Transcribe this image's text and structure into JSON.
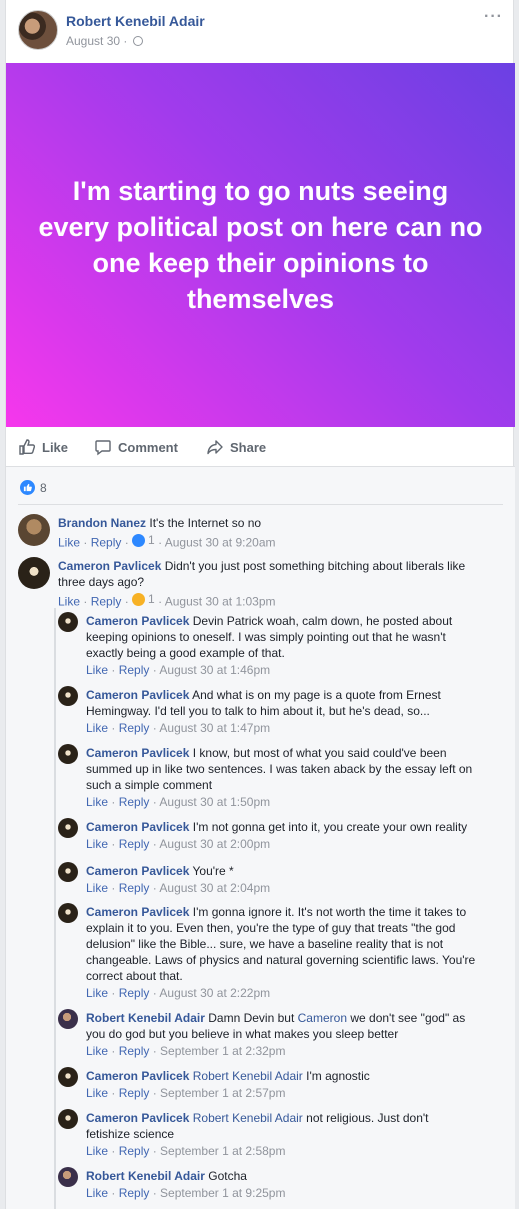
{
  "post": {
    "author": "Robert Kenebil Adair",
    "date": "August 30 ·",
    "more": "···",
    "status_text": "I'm starting to go nuts seeing every political post on here can no one keep their opinions to themselves",
    "banner_gradient": [
      "#f637ec",
      "#a13bec",
      "#6b40e3"
    ]
  },
  "actions": {
    "like": "Like",
    "comment": "Comment",
    "share": "Share"
  },
  "reactions": {
    "count": "8"
  },
  "comments": [
    {
      "name": "Brandon Nanez",
      "text": "It's the Internet so no",
      "like": "Like",
      "reply": "Reply",
      "react_count": "1",
      "time": "August 30 at 9:20am"
    },
    {
      "name": "Cameron Pavlicek",
      "text": "Didn't you just post something bitching about liberals like three days ago?",
      "like": "Like",
      "reply": "Reply",
      "react_count": "1",
      "time": "August 30 at 1:03pm"
    }
  ],
  "replies": [
    {
      "name": "Cameron Pavlicek",
      "tag": "",
      "text": "Devin Patrick woah, calm down, he posted about keeping opinions to oneself. I was simply pointing out that he wasn't exactly being a good example of that.",
      "like": "Like",
      "reply": "Reply",
      "time": "August 30 at 1:46pm"
    },
    {
      "name": "Cameron Pavlicek",
      "tag": "",
      "text": "And what is on my page is a quote from Ernest Hemingway. I'd tell you to talk to him about it, but he's dead, so...",
      "like": "Like",
      "reply": "Reply",
      "time": "August 30 at 1:47pm"
    },
    {
      "name": "Cameron Pavlicek",
      "tag": "",
      "text": "I know, but most of what you said could've been summed up in like two sentences. I was taken aback by the essay left on such a simple comment",
      "like": "Like",
      "reply": "Reply",
      "time": "August 30 at 1:50pm"
    },
    {
      "name": "Cameron Pavlicek",
      "tag": "",
      "text": "I'm not gonna get into it, you create your own reality",
      "like": "Like",
      "reply": "Reply",
      "time": "August 30 at 2:00pm"
    },
    {
      "name": "Cameron Pavlicek",
      "tag": "",
      "text": "You're *",
      "like": "Like",
      "reply": "Reply",
      "time": "August 30 at 2:04pm"
    },
    {
      "name": "Cameron Pavlicek",
      "tag": "",
      "text": "I'm gonna ignore it. It's not worth the time it takes to explain it to you. Even then, you're the type of guy that treats \"the god delusion\" like the Bible... sure, we have a baseline reality that is not changeable. Laws of physics and natural governing scientific laws. You're correct about that.",
      "like": "Like",
      "reply": "Reply",
      "time": "August 30 at 2:22pm"
    },
    {
      "name": "Robert Kenebil Adair",
      "tag": "",
      "text_pre": "Damn Devin but",
      "tag_mid": "Cameron",
      "text_post": "we don't see \"god\" as you do god but you believe in what makes you sleep better",
      "like": "Like",
      "reply": "Reply",
      "time": "September 1 at 2:32pm"
    },
    {
      "name": "Cameron Pavlicek",
      "tag": "Robert Kenebil Adair",
      "text": "I'm agnostic",
      "like": "Like",
      "reply": "Reply",
      "time": "September 1 at 2:57pm"
    },
    {
      "name": "Cameron Pavlicek",
      "tag": "Robert Kenebil Adair",
      "text": "not religious. Just don't fetishize science",
      "like": "Like",
      "reply": "Reply",
      "time": "September 1 at 2:58pm"
    },
    {
      "name": "Robert Kenebil Adair",
      "tag": "",
      "text": "Gotcha",
      "like": "Like",
      "reply": "Reply",
      "time": "September 1 at 9:25pm"
    }
  ]
}
